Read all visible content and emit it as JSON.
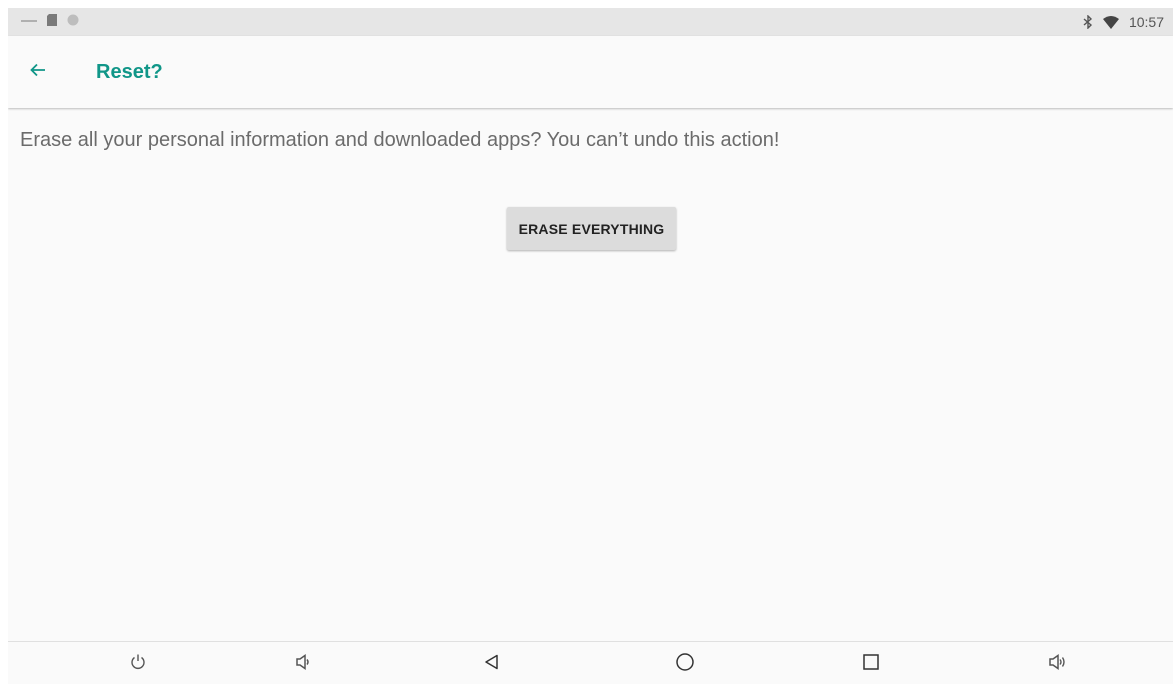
{
  "status_bar": {
    "time": "10:57",
    "icons": [
      "minus-icon",
      "sd-card-icon",
      "circle-icon",
      "bluetooth-icon",
      "wifi-icon"
    ]
  },
  "app_bar": {
    "back_icon": "arrow-back-icon",
    "title": "Reset?",
    "accent_color": "#109688"
  },
  "content": {
    "message": "Erase all your personal information and downloaded apps? You can’t undo this action!",
    "erase_button_label": "ERASE EVERYTHING"
  },
  "nav_bar": {
    "buttons": [
      "power-icon",
      "volume-down-icon",
      "back-triangle-icon",
      "home-circle-icon",
      "recents-square-icon",
      "volume-up-icon"
    ]
  }
}
